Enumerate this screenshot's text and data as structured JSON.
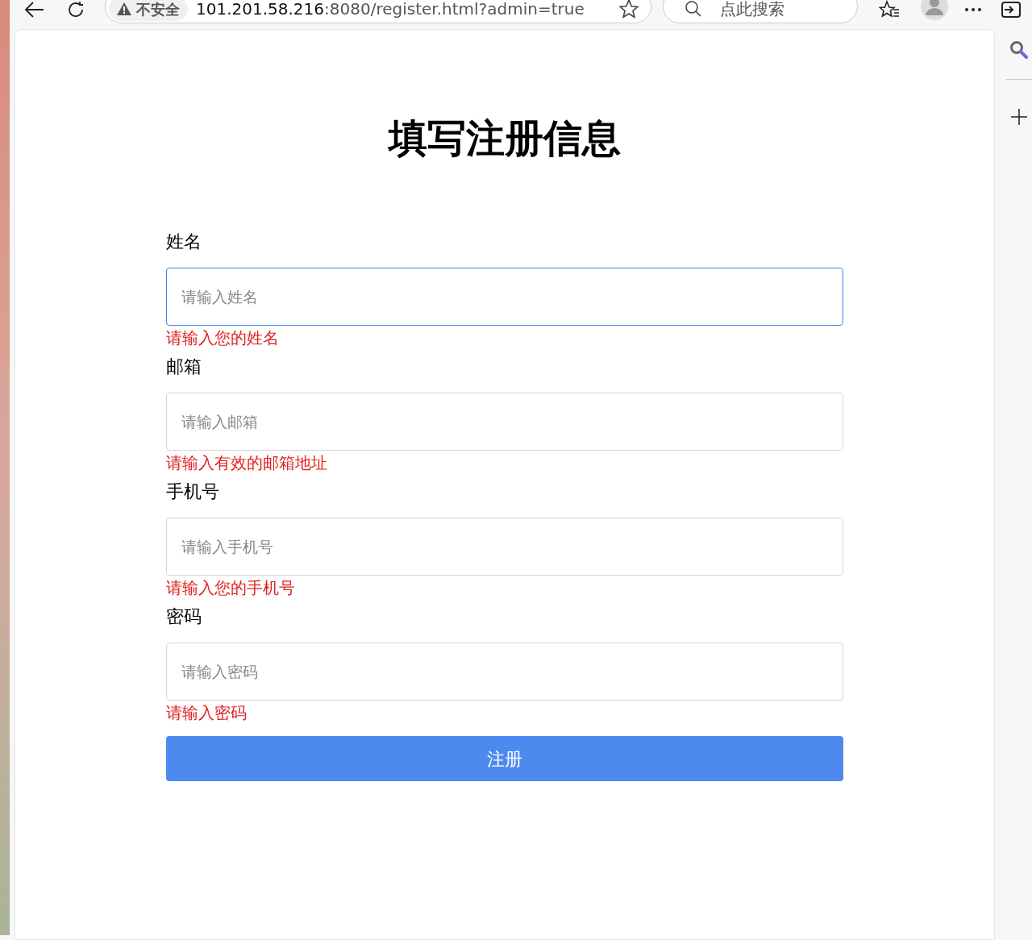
{
  "browser": {
    "security_label": "不安全",
    "url_host": "101.201.58.216",
    "url_rest": ":8080/register.html?admin=true",
    "search_placeholder": "点此搜索"
  },
  "form": {
    "title": "填写注册信息",
    "fields": [
      {
        "label": "姓名",
        "placeholder": "请输入姓名",
        "error": "请输入您的姓名",
        "focused": true
      },
      {
        "label": "邮箱",
        "placeholder": "请输入邮箱",
        "error": "请输入有效的邮箱地址",
        "focused": false
      },
      {
        "label": "手机号",
        "placeholder": "请输入手机号",
        "error": "请输入您的手机号",
        "focused": false
      },
      {
        "label": "密码",
        "placeholder": "请输入密码",
        "error": "请输入密码",
        "focused": false
      }
    ],
    "submit": "注册"
  }
}
